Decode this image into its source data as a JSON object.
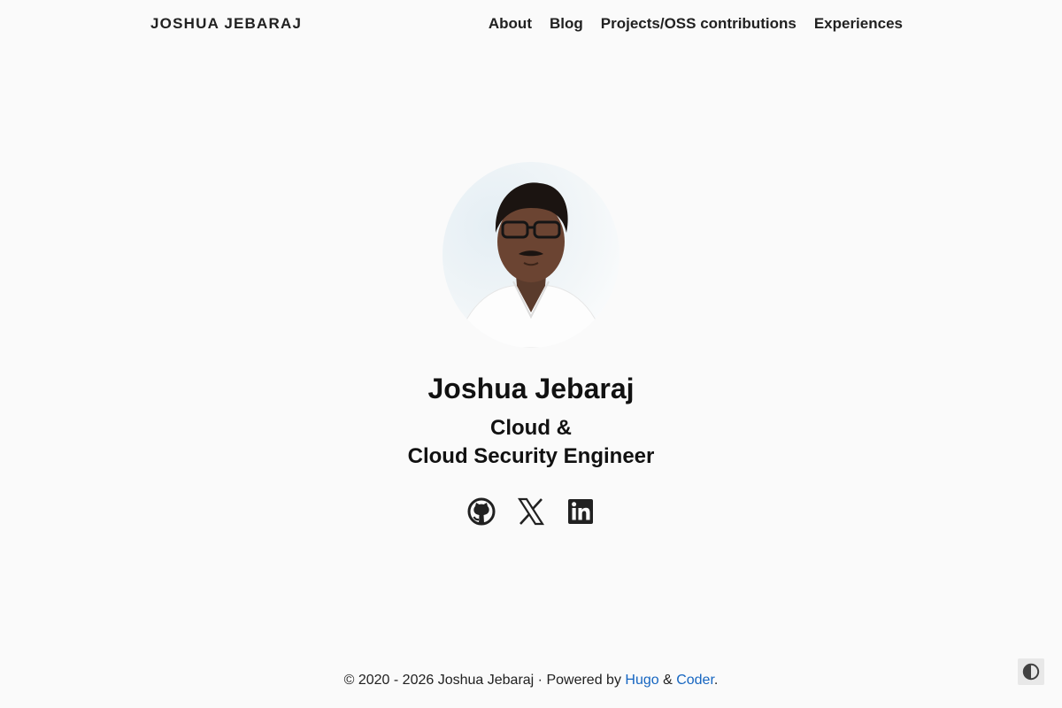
{
  "site": {
    "brand": "JOSHUA JEBARAJ",
    "nav": [
      {
        "label": "About"
      },
      {
        "label": "Blog"
      },
      {
        "label": "Projects/OSS contributions"
      },
      {
        "label": "Experiences"
      }
    ]
  },
  "profile": {
    "avatar_alt": "avatar",
    "name": "Joshua Jebaraj",
    "role_line1": "Cloud &",
    "role_line2": "Cloud Security Engineer"
  },
  "social": [
    {
      "icon": "github-icon"
    },
    {
      "icon": "x-icon"
    },
    {
      "icon": "linkedin-icon"
    }
  ],
  "footer": {
    "copyright": "© 2020 - 2026 Joshua Jebaraj · Powered by ",
    "hugo": "Hugo",
    "amp": " & ",
    "coder": "Coder",
    "end": "."
  },
  "theme_toggle": {
    "icon": "contrast-icon"
  },
  "colors": {
    "background": "#fafafa",
    "text": "#212121",
    "link": "#1565c0"
  }
}
